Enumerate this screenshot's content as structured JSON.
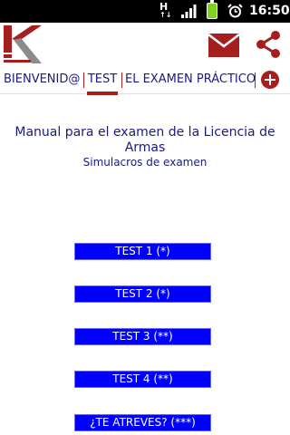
{
  "status_bar": {
    "time": "16:50",
    "network_type": "H",
    "battery_color": "#7ed321"
  },
  "header": {
    "logo_icon": "k-logo-icon",
    "mail_icon": "mail-icon",
    "share_icon": "share-icon",
    "brand_color": "#a51f1f"
  },
  "tabs": [
    {
      "label": "BIENVENID@"
    },
    {
      "label": "TEST",
      "active": true
    },
    {
      "label": "EL EXAMEN PRÁCTICO"
    }
  ],
  "main": {
    "title": "Manual para el examen de la Licencia de Armas",
    "subtitle": "Simulacros de examen",
    "buttons": [
      {
        "label": "TEST 1 (*)"
      },
      {
        "label": "TEST 2 (*)"
      },
      {
        "label": "TEST 3 (**)"
      },
      {
        "label": "TEST 4 (**)"
      },
      {
        "label": "¿TE ATREVES? (***)"
      }
    ],
    "button_color": "#0000ff",
    "text_color": "#1a1a80"
  }
}
